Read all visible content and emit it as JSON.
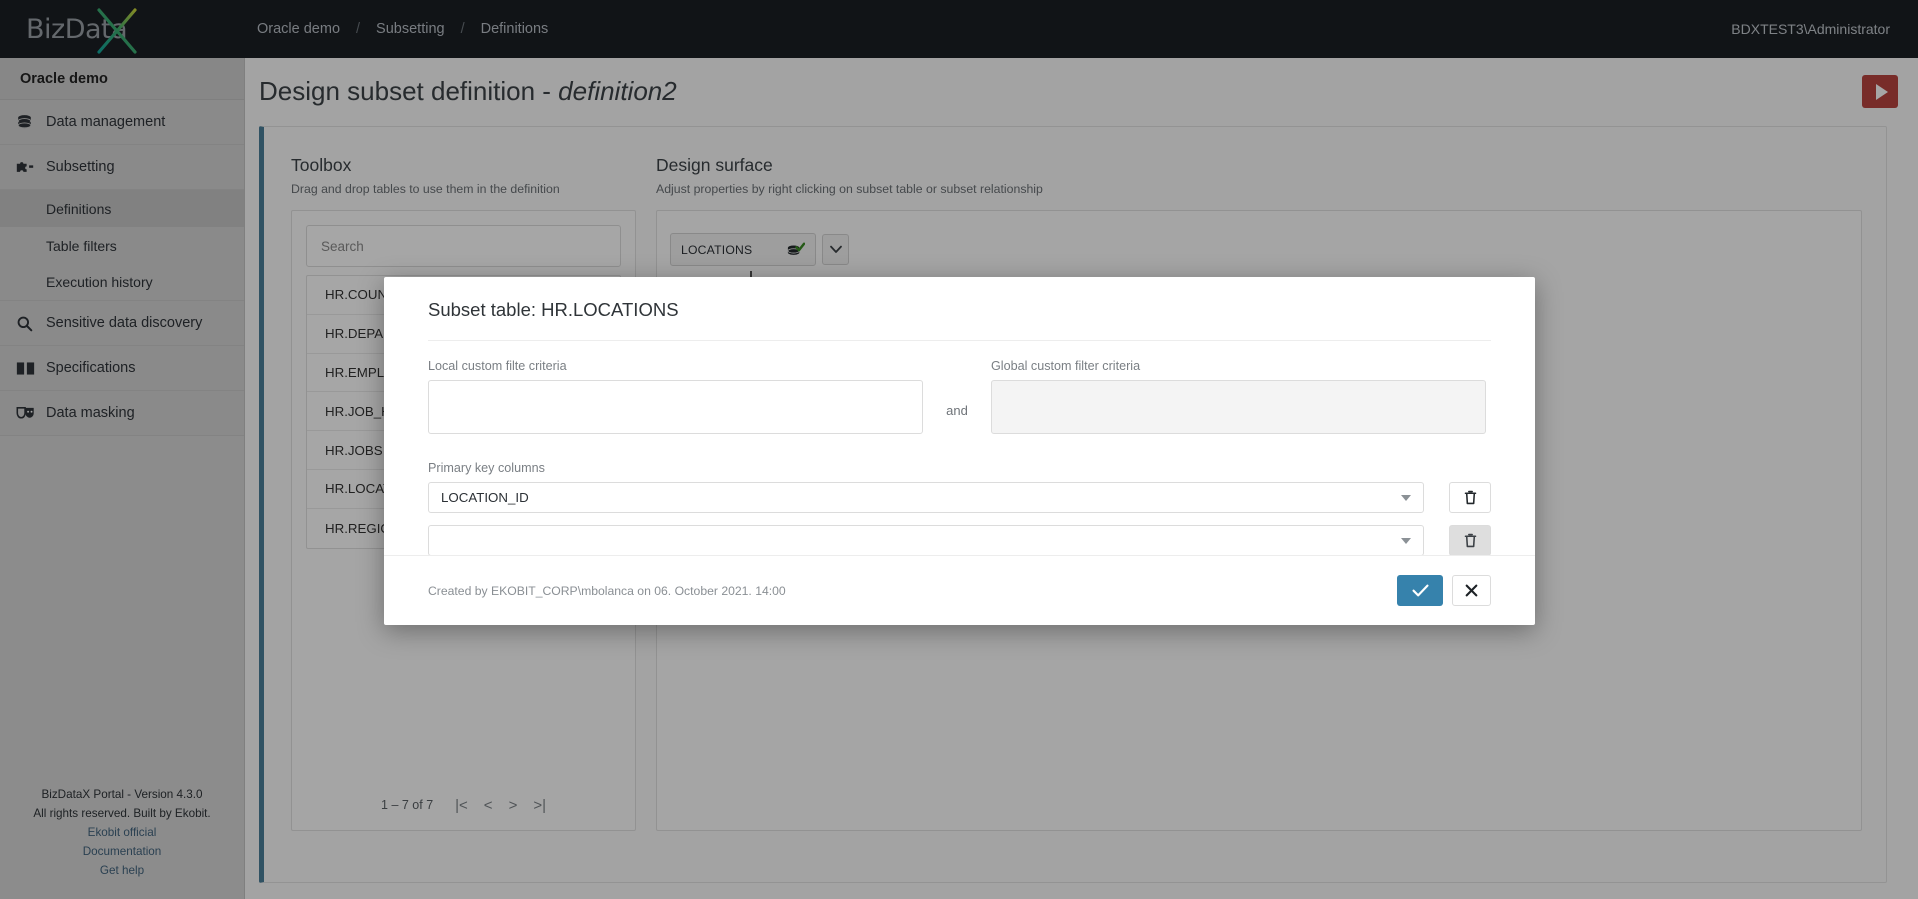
{
  "topbar": {
    "logo_text": "BizData",
    "logo_x": "X",
    "breadcrumb": [
      "Oracle demo",
      "Subsetting",
      "Definitions"
    ],
    "separator": "/",
    "user": "BDXTEST3\\Administrator"
  },
  "sidebar": {
    "title": "Oracle demo",
    "items": [
      {
        "label": "Data management",
        "icon": "database-icon",
        "type": "top"
      },
      {
        "label": "Subsetting",
        "icon": "puzzle-icon",
        "type": "top"
      },
      {
        "label": "Definitions",
        "icon": "",
        "type": "sub",
        "active": true
      },
      {
        "label": "Table filters",
        "icon": "",
        "type": "sub",
        "active": false
      },
      {
        "label": "Execution history",
        "icon": "",
        "type": "sub",
        "active": false
      },
      {
        "label": "Sensitive data discovery",
        "icon": "magnifier-icon",
        "type": "top"
      },
      {
        "label": "Specifications",
        "icon": "book-icon",
        "type": "top"
      },
      {
        "label": "Data masking",
        "icon": "masks-icon",
        "type": "top"
      }
    ],
    "footer": {
      "version": "BizDataX Portal - Version 4.3.0",
      "rights": "All rights reserved. Built by Ekobit.",
      "links": [
        "Ekobit official",
        "Documentation",
        "Get help"
      ]
    }
  },
  "page": {
    "title_prefix": "Design subset definition - ",
    "title_name": "definition2",
    "run_button": "run-icon"
  },
  "toolbox": {
    "heading": "Toolbox",
    "subheading": "Drag and drop tables to use them in the definition",
    "search_placeholder": "Search",
    "search_value": "",
    "tables": [
      "HR.COUNTRIES",
      "HR.DEPARTMENTS",
      "HR.EMPLOYEES",
      "HR.JOB_HISTORY",
      "HR.JOBS",
      "HR.LOCATIONS",
      "HR.REGIONS"
    ],
    "paginator": {
      "range": "1 – 7 of 7",
      "first": "|<",
      "prev": "<",
      "next": ">",
      "last": ">|"
    }
  },
  "surface": {
    "heading": "Design surface",
    "subheading": "Adjust properties by right clicking on subset table or subset relationship",
    "nodes": [
      {
        "label": "LOCATIONS",
        "icon": "database-check-icon",
        "chevron": "chevron-down-icon"
      }
    ]
  },
  "modal": {
    "title": "Subset table: HR.LOCATIONS",
    "local_filter_label": "Local custom filte criteria",
    "local_filter_value": "",
    "and_label": "and",
    "global_filter_label": "Global custom filter criteria",
    "global_filter_value": "",
    "pk_label": "Primary key columns",
    "pk_rows": [
      {
        "value": "LOCATION_ID",
        "delete_enabled": true
      },
      {
        "value": "",
        "delete_enabled": false
      }
    ],
    "created_text": "Created by EKOBIT_CORP\\mbolanca on 06. October 2021. 14:00",
    "confirm_label": "✔",
    "cancel_label": "✕"
  },
  "colors": {
    "topbar_bg": "#1b1f24",
    "accent_border": "#4a7f99",
    "primary_button": "#3682ac",
    "run_button": "#b8443f",
    "node_check": "#3a8a24"
  }
}
